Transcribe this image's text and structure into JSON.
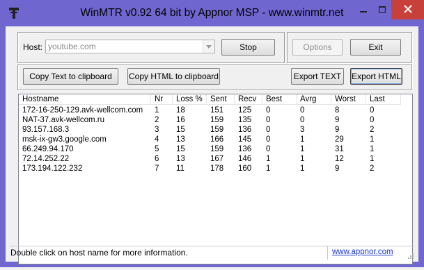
{
  "window": {
    "title": "WinMTR v0.92 64 bit by Appnor MSP - www.winmtr.net",
    "accent_color": "#6f66cf",
    "close_color": "#c7413a"
  },
  "host": {
    "label": "Host:",
    "value": "youtube.com"
  },
  "buttons": {
    "stop": "Stop",
    "options": "Options",
    "exit": "Exit",
    "copy_text": "Copy Text to clipboard",
    "copy_html": "Copy HTML to clipboard",
    "export_text": "Export TEXT",
    "export_html": "Export HTML"
  },
  "table": {
    "columns": [
      "Hostname",
      "Nr",
      "Loss %",
      "Sent",
      "Recv",
      "Best",
      "Avrg",
      "Worst",
      "Last"
    ],
    "rows": [
      [
        "172-16-250-129.avk-wellcom.com",
        "1",
        "18",
        "151",
        "125",
        "0",
        "0",
        "8",
        "0"
      ],
      [
        "NAT-37.avk-wellcom.ru",
        "2",
        "16",
        "159",
        "135",
        "0",
        "0",
        "9",
        "0"
      ],
      [
        "93.157.168.3",
        "3",
        "15",
        "159",
        "136",
        "0",
        "3",
        "9",
        "2"
      ],
      [
        "msk-ix-gw3.google.com",
        "4",
        "13",
        "166",
        "145",
        "0",
        "1",
        "29",
        "1"
      ],
      [
        "66.249.94.170",
        "5",
        "15",
        "159",
        "136",
        "0",
        "1",
        "31",
        "1"
      ],
      [
        "72.14.252.22",
        "6",
        "13",
        "167",
        "146",
        "1",
        "1",
        "12",
        "1"
      ],
      [
        "173.194.122.232",
        "7",
        "11",
        "178",
        "160",
        "1",
        "1",
        "9",
        "2"
      ]
    ]
  },
  "status": {
    "message": "Double click on host name for more information.",
    "link": "www.appnor.com"
  }
}
